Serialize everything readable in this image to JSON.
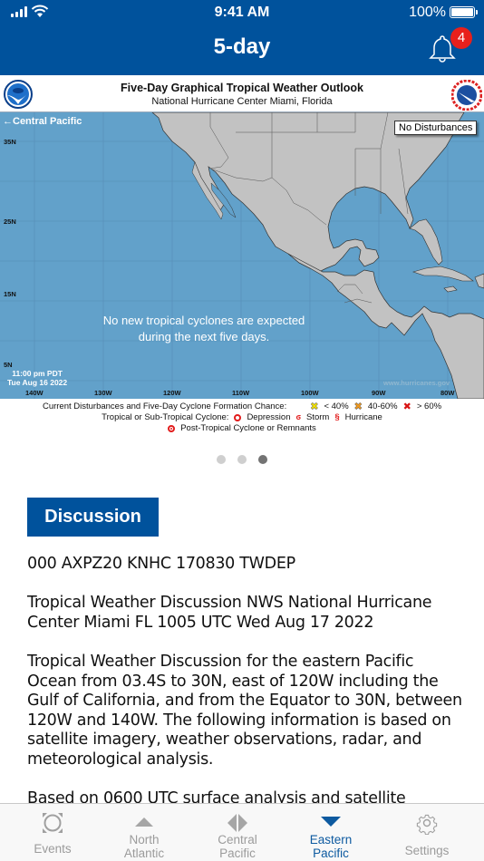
{
  "status_bar": {
    "time": "9:41 AM",
    "battery_percent": "100%"
  },
  "header": {
    "title": "5-day",
    "notification_count": "4"
  },
  "graphic": {
    "title": "Five-Day Graphical Tropical Weather Outlook",
    "subtitle": "National Hurricane Center  Miami, Florida",
    "back_link": "←Central Pacific",
    "status_box": "No Disturbances",
    "message_line1": "No new tropical cyclones are expected",
    "message_line2": "during the next five days.",
    "timestamp_line1": "11:00 pm PDT",
    "timestamp_line2": "Tue Aug 16 2022",
    "watermark": "www.hurricanes.gov",
    "latitude_labels": [
      "35N",
      "25N",
      "15N",
      "5N"
    ],
    "longitude_labels": [
      "140W",
      "130W",
      "120W",
      "110W",
      "100W",
      "90W",
      "80W"
    ],
    "legend": {
      "row1_label": "Current Disturbances and Five-Day Cyclone Formation Chance:",
      "chance_low": "< 40%",
      "chance_mid": "40-60%",
      "chance_high": "> 60%",
      "row2_label": "Tropical or Sub-Tropical Cyclone:",
      "depression": "Depression",
      "storm": "Storm",
      "hurricane": "Hurricane",
      "post_tropical": "Post-Tropical Cyclone or Remnants",
      "colors": {
        "low": "#f5e400",
        "mid": "#f39a1c",
        "high": "#d81414",
        "cyclone": "#e21c1c"
      }
    }
  },
  "pager": {
    "pages": 3,
    "active_index": 2
  },
  "discussion": {
    "button_label": "Discussion",
    "paragraphs": [
      "000 AXPZ20 KNHC 170830 TWDEP",
      "Tropical Weather Discussion NWS National Hurricane Center Miami FL 1005 UTC Wed Aug 17 2022",
      "Tropical Weather Discussion for the eastern Pacific Ocean from 03.4S to 30N, east of 120W including the Gulf of California, and from the Equator to 30N, between 120W and 140W. The following information is based on satellite imagery, weather observations, radar, and meteorological analysis.",
      "Based on 0600 UTC surface analysis and satellite"
    ]
  },
  "tabbar": {
    "active": "eastern-pacific",
    "accent_color": "#0d5aa0",
    "items": [
      {
        "id": "events",
        "label": "Events",
        "icon": "events-icon"
      },
      {
        "id": "north-atlantic",
        "label_line1": "North",
        "label_line2": "Atlantic",
        "icon": "triangle-up-icon"
      },
      {
        "id": "central-pacific",
        "label_line1": "Central",
        "label_line2": "Pacific",
        "icon": "diamond-split-icon"
      },
      {
        "id": "eastern-pacific",
        "label_line1": "Eastern",
        "label_line2": "Pacific",
        "icon": "triangle-down-icon"
      },
      {
        "id": "settings",
        "label": "Settings",
        "icon": "gear-icon"
      }
    ]
  }
}
